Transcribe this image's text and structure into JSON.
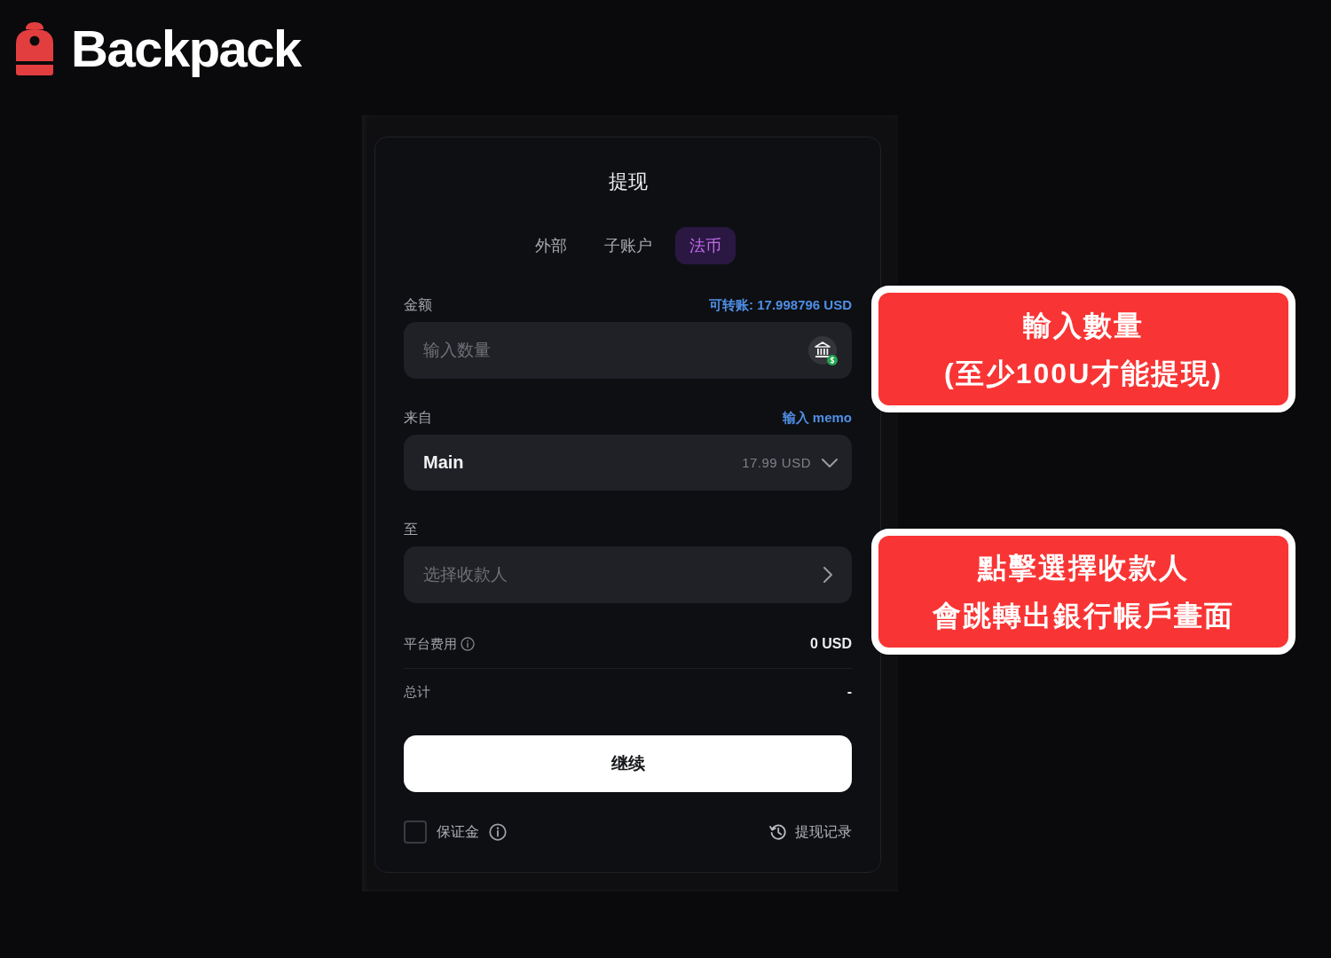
{
  "logo": {
    "text": "Backpack"
  },
  "dialog": {
    "title": "提现",
    "tabs": [
      {
        "label": "外部",
        "selected": false
      },
      {
        "label": "子账户",
        "selected": false
      },
      {
        "label": "法币",
        "selected": true
      }
    ],
    "amount": {
      "label": "金额",
      "available": "可转账: 17.998796 USD",
      "placeholder": "输入数量"
    },
    "from": {
      "label": "来自",
      "memo_link": "输入 memo",
      "account": "Main",
      "balance": "17.99 USD"
    },
    "to": {
      "label": "至",
      "placeholder": "选择收款人"
    },
    "summary": [
      {
        "label": "平台费用",
        "info": true,
        "value": "0 USD"
      },
      {
        "label": "总计",
        "info": false,
        "value": "-"
      }
    ],
    "continue_button": "继续",
    "margin_checkbox": {
      "label": "保证金",
      "checked": false
    },
    "history_link": "提现记录"
  },
  "annotations": [
    {
      "lines": [
        "輸入數量",
        "(至少100U才能提現)"
      ]
    },
    {
      "lines": [
        "點擊選擇收款人",
        "會跳轉出銀行帳戶畫面"
      ]
    }
  ]
}
